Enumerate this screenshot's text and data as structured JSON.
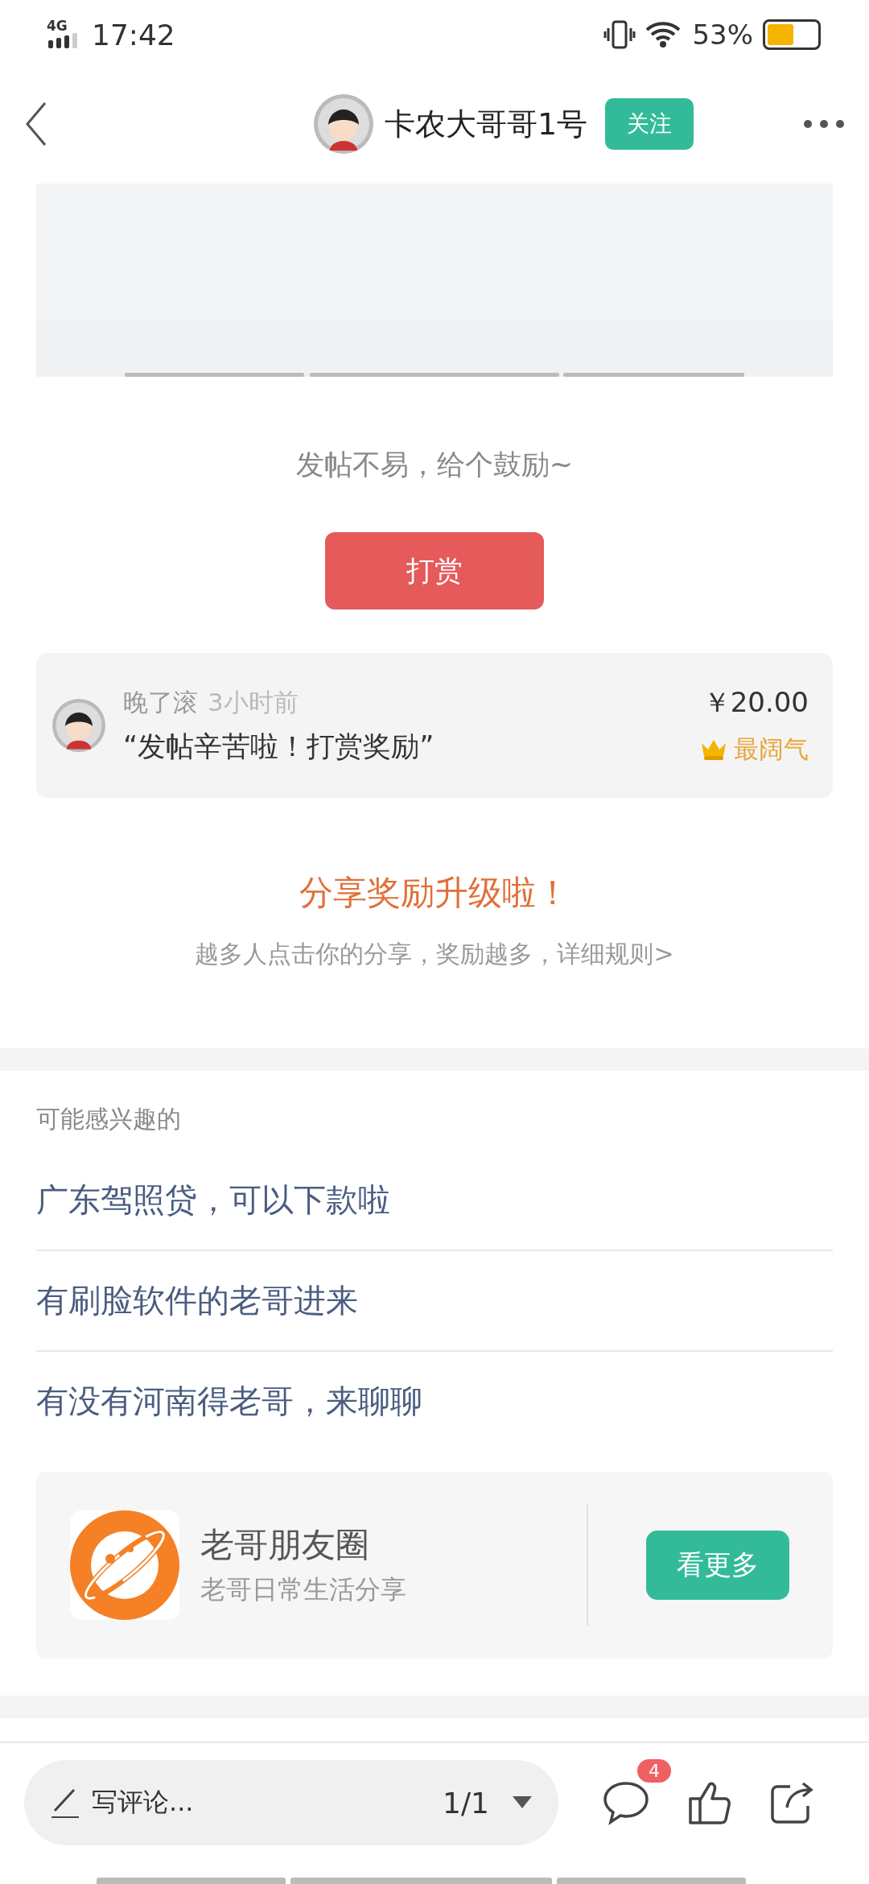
{
  "status_bar": {
    "network": "4G",
    "time": "17:42",
    "battery": "53%"
  },
  "header": {
    "author": "卡农大哥哥1号",
    "follow_button": "关注"
  },
  "reward": {
    "prompt": "发帖不易，给个鼓励~",
    "button": "打赏",
    "record": {
      "user": "晚了滚",
      "time": "3小时前",
      "message": "“发帖辛苦啦！打赏奖励”",
      "amount": "￥20.00",
      "badge": "最阔气"
    }
  },
  "share": {
    "title": "分享奖励升级啦！",
    "subtitle": "越多人点击你的分享，奖励越多，详细规则>"
  },
  "related": {
    "heading": "可能感兴趣的",
    "items": [
      {
        "title": "广东驾照贷，可以下款啦"
      },
      {
        "title": "有刷脸软件的老哥进来"
      },
      {
        "title": "有没有河南得老哥，来聊聊"
      }
    ]
  },
  "circle": {
    "name": "老哥朋友圈",
    "description": "老哥日常生活分享",
    "button": "看更多"
  },
  "bottom_bar": {
    "comment_placeholder": "写评论...",
    "page": "1/1",
    "comment_count": "4"
  }
}
